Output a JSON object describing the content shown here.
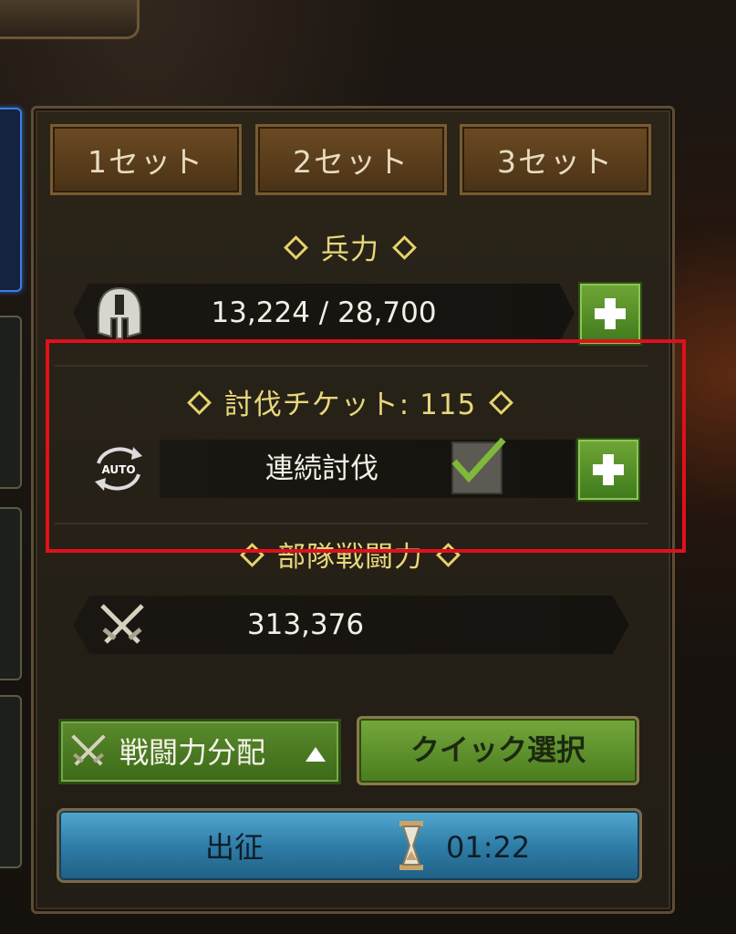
{
  "sets": [
    "1セット",
    "2セット",
    "3セット"
  ],
  "troops": {
    "title": "兵力",
    "value": "13,224 / 28,700"
  },
  "ticket": {
    "title": "討伐チケット: 115",
    "auto_label": "連続討伐",
    "auto_icon_text": "AUTO",
    "checked": true
  },
  "power": {
    "title": "部隊戦闘力",
    "value": "313,376"
  },
  "buttons": {
    "distribute": "戦闘力分配",
    "quick_select": "クイック選択",
    "depart": "出征",
    "timer": "01:22"
  },
  "colors": {
    "highlight": "#e0101c",
    "title": "#e8d77a",
    "green": "#4a7c1e",
    "blue": "#2f7ea8"
  },
  "icons": [
    "helmet-icon",
    "auto-repeat-icon",
    "crossed-swords-icon",
    "hourglass-icon",
    "plus-icon",
    "checkmark-icon",
    "triangle-up-icon"
  ]
}
